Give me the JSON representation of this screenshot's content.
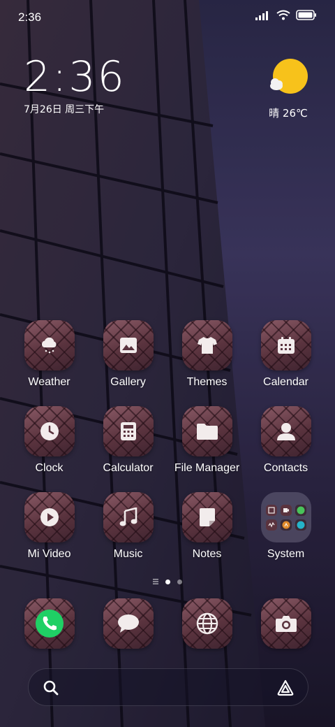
{
  "status_bar": {
    "time": "2:36"
  },
  "clock_widget": {
    "time": "2:36",
    "date": "7月26日 周三下午"
  },
  "weather_widget": {
    "text": "晴 26℃",
    "icon": "sun-cloud-icon"
  },
  "apps": {
    "row1": [
      "Weather",
      "Gallery",
      "Themes",
      "Calendar"
    ],
    "row2": [
      "Clock",
      "Calculator",
      "File Manager",
      "Contacts"
    ],
    "row3": [
      "Mi Video",
      "Music",
      "Notes",
      "System"
    ]
  },
  "dock": [
    "phone-icon",
    "messages-icon",
    "browser-icon",
    "camera-icon"
  ],
  "page_indicator": {
    "pages": 2,
    "current": 1
  },
  "search": {
    "icon": "search-icon",
    "assistant_icon": "assistant-icon"
  },
  "colors": {
    "tile": "#5a333e",
    "phone_green": "#1fd065",
    "sun": "#f7c21b"
  }
}
